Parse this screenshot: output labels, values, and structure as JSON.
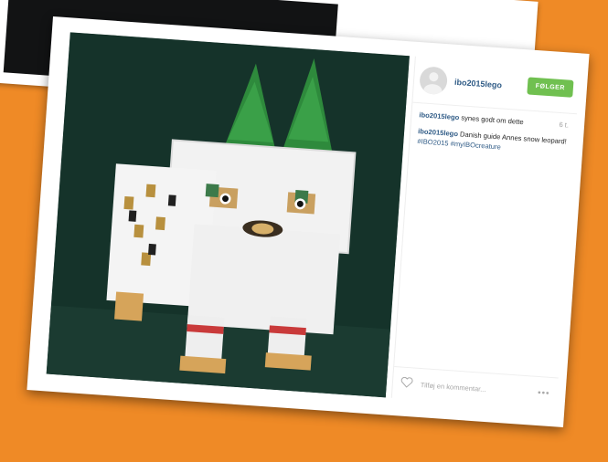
{
  "background_color": "#ef8a26",
  "post": {
    "username": "ibo2015lego",
    "follow_label": "FØLGER",
    "like_user": "ibo2015lego",
    "like_text": "synes godt om dette",
    "time": "6 t.",
    "caption_user": "ibo2015lego",
    "caption_text": "Danish guide Annes snow leopard!",
    "caption_tags": "#IBO2015 #myIBOcreature",
    "comment_placeholder": "Tilføj en kommentar...",
    "more_label": "•••"
  },
  "back_card": {
    "more_label": "•••"
  },
  "icons": {
    "avatar": "default-avatar-icon",
    "heart": "heart-outline-icon",
    "more": "ellipsis-icon"
  },
  "colors": {
    "follow_button": "#70c050",
    "username": "#2f5b86"
  }
}
